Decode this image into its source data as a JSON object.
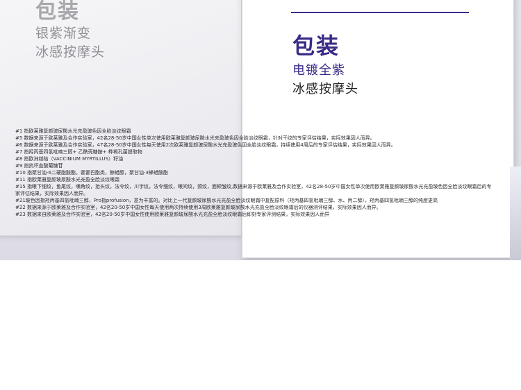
{
  "left_card": {
    "title": "包装",
    "line1": "银紫渐变",
    "line2": "冰感按摩头"
  },
  "right_card": {
    "title": "包装",
    "line1": "电镀全紫",
    "line2": "冰感按摩头"
  },
  "footnotes": [
    "#1 指欧莱雅复颜玻尿酸水光充盈玻色因全脸淡纹眼霜",
    "#5 数据来源于欧莱雅及合作实验室，42名28-50岁中国女性单次使用欧莱雅复颜玻尿酸水光充盈玻色因全脸淡纹眼霜，针对干纹的专家评估结果，实际效果因人而异。",
    "#6 数据来源于欧莱雅及合作实验室，47名28-50岁中国女性每天使用2次欧莱雅复颜玻尿酸水光充盈玻色因全脸淡纹眼霜，持续使用4周后的专家评估结果，实际效果因人而异。",
    "#7 指羟丙基四氢吡喃三醇+ 乙酰壳糖胺+ 桦褐孔菌提取物",
    "#8 指欧洲越桔（VACCINIUM MYRTILLUS）籽油",
    "#9 指抗坏血酸葡糖苷",
    "#10 指聚甘油-6二硬脂酸酯，霍霍巴酯类，鲸蜡醇，聚甘油-3蜂蜡酸酯",
    "#11 指欧莱雅复颜玻尿酸水光充盈全脸淡纹眼霜",
    "#15 指眼下细纹，鱼尾纹，嘴角纹，抬头纹，法令纹，川字纹，法令细纹，眼间纹，颈纹，面颊皱纹,数据来源于欧莱雅及合作实验室，42名28-50岁中国女性单次使用欧莱雅复颜玻尿酸水光充盈玻色因全脸淡纹眼霜后的专家评估结果，实际效果因人而异。",
    "#21玻色因指羟丙基四氢吡喃三醇，Pro指profusion，意为丰富的。对比上一代复颜玻尿酸水光充盈全脸淡纹眼霜中复配原料（羟丙基四氢吡喃三醇、水、丙二醇），羟丙基四氢吡喃三醇的纯度更高",
    "#22 数据来源于欧莱雅及合作实验室，42名20-50岁中国女性每天使用两次持续使用3周欧莱雅复颜玻尿酸水光充盈全脸淡纹眼霜后的仪器测评结果，实际效果因人而异。",
    "#23 数据来自欧莱雅及合作实验室，42名20-50岁中国女性使用欧莱雅复颜玻尿酸水光充盈全脸淡纹眼霜后即刻专家评测结果，实际效果因人而异"
  ]
}
